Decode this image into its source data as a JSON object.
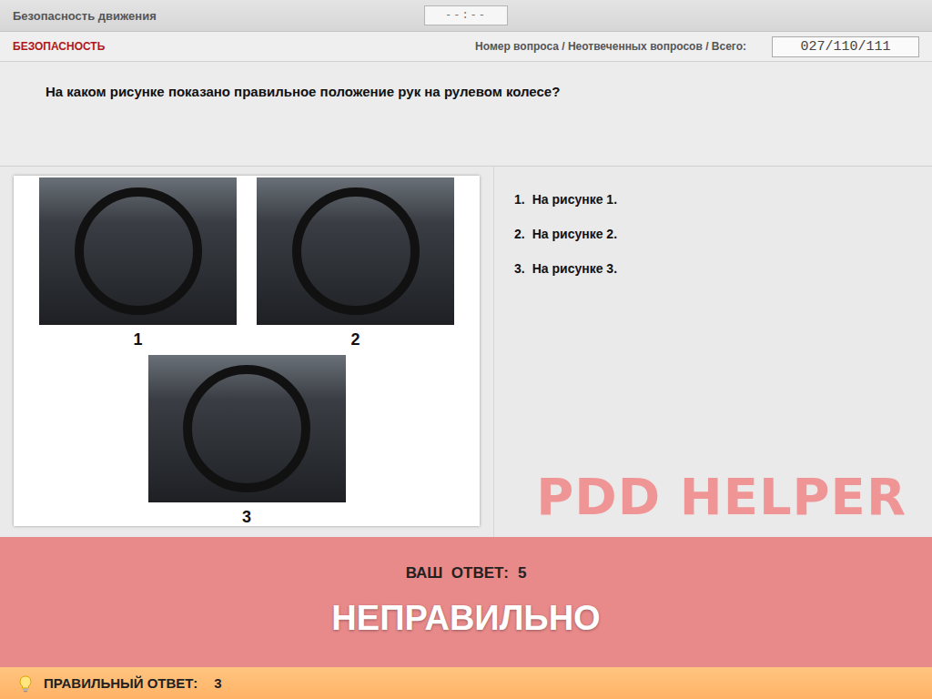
{
  "header": {
    "title": "Безопасность движения",
    "timer": "--:--"
  },
  "subheader": {
    "section": "БЕЗОПАСНОСТЬ",
    "counter_label": "Номер вопроса / Неотвеченных вопросов / Всего:",
    "counter": "027/110/111"
  },
  "question": "На каком рисунке показано правильное положение рук на рулевом колесе?",
  "pictures": [
    {
      "label": "1"
    },
    {
      "label": "2"
    },
    {
      "label": "3"
    }
  ],
  "answers": [
    {
      "number": "1.",
      "text": "На рисунке 1.",
      "selected": false
    },
    {
      "number": "2.",
      "text": "На рисунке 2.",
      "selected": false
    },
    {
      "number": "3.",
      "text": "На рисунке 3.",
      "selected": false
    }
  ],
  "watermark": "PDD HELPER",
  "result": {
    "your_answer_label": "ВАШ  ОТВЕТ:",
    "your_answer": "5",
    "verdict": "НЕПРАВИЛЬНО"
  },
  "hint": {
    "label": "ПРАВИЛЬНЫЙ ОТВЕТ:",
    "answer": "3"
  }
}
